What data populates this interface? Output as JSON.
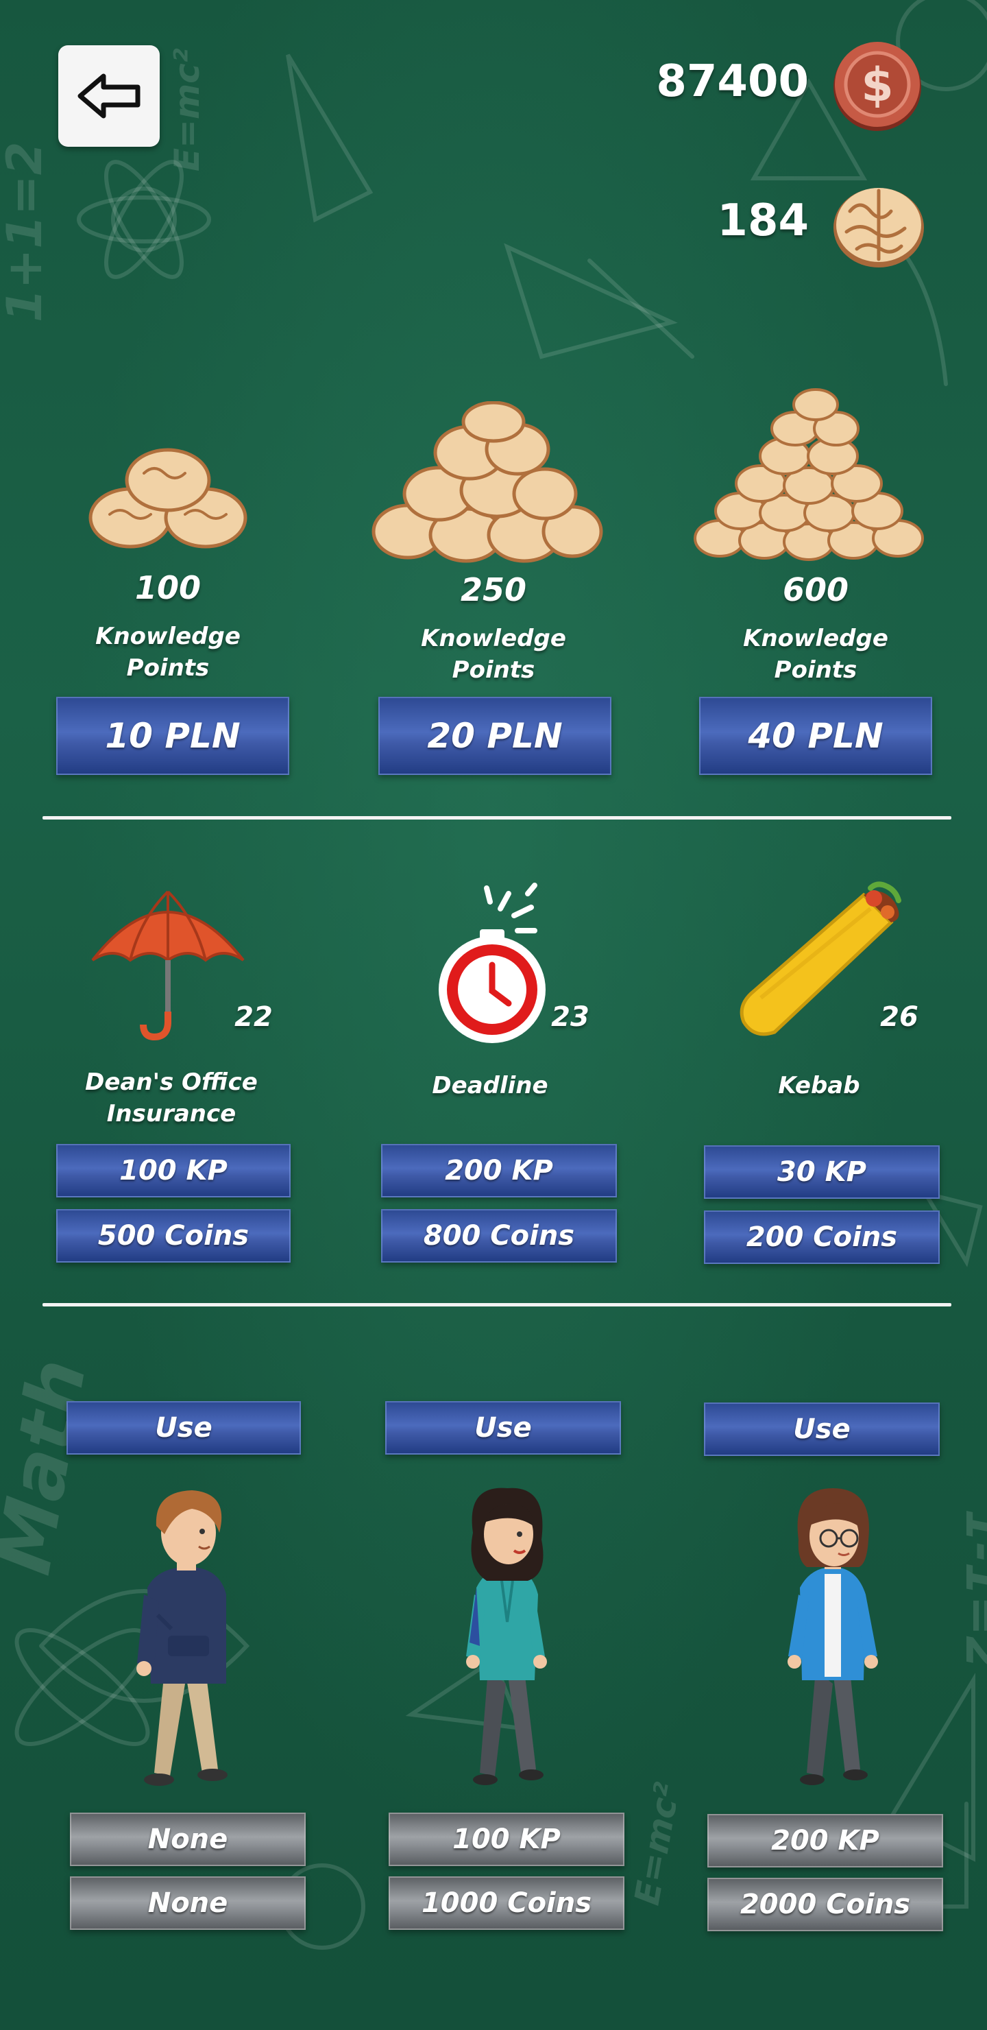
{
  "header": {
    "coins": "87400",
    "knowledge_points": "184",
    "back_icon": "arrow-left-icon",
    "coin_icon": "dollar-coin-icon",
    "kp_icon": "brain-icon"
  },
  "kp_packs": [
    {
      "amount": "100",
      "label": "Knowledge Points",
      "price": "10 PLN",
      "icon": "brain-pile-small-icon"
    },
    {
      "amount": "250",
      "label": "Knowledge Points",
      "price": "20 PLN",
      "icon": "brain-pile-medium-icon"
    },
    {
      "amount": "600",
      "label": "Knowledge Points",
      "price": "40 PLN",
      "icon": "brain-pile-large-icon"
    }
  ],
  "items": [
    {
      "name": "Dean's Office Insurance",
      "owned": "22",
      "kp_price": "100 KP",
      "coin_price": "500 Coins",
      "icon": "umbrella-icon"
    },
    {
      "name": "Deadline",
      "owned": "23",
      "kp_price": "200 KP",
      "coin_price": "800 Coins",
      "icon": "stopwatch-bomb-icon"
    },
    {
      "name": "Kebab",
      "owned": "26",
      "kp_price": "30 KP",
      "coin_price": "200 Coins",
      "icon": "kebab-wrap-icon"
    }
  ],
  "characters": [
    {
      "use_label": "Use",
      "kp_price": "None",
      "coin_price": "None",
      "avatar": "student-boy-hoodie"
    },
    {
      "use_label": "Use",
      "kp_price": "100 KP",
      "coin_price": "1000 Coins",
      "avatar": "student-girl-curly"
    },
    {
      "use_label": "Use",
      "kp_price": "200 KP",
      "coin_price": "2000 Coins",
      "avatar": "student-girl-glasses"
    }
  ],
  "colors": {
    "board_green": "#1b6147",
    "button_blue": "#3f5aa8",
    "button_grey": "#8d9196"
  }
}
